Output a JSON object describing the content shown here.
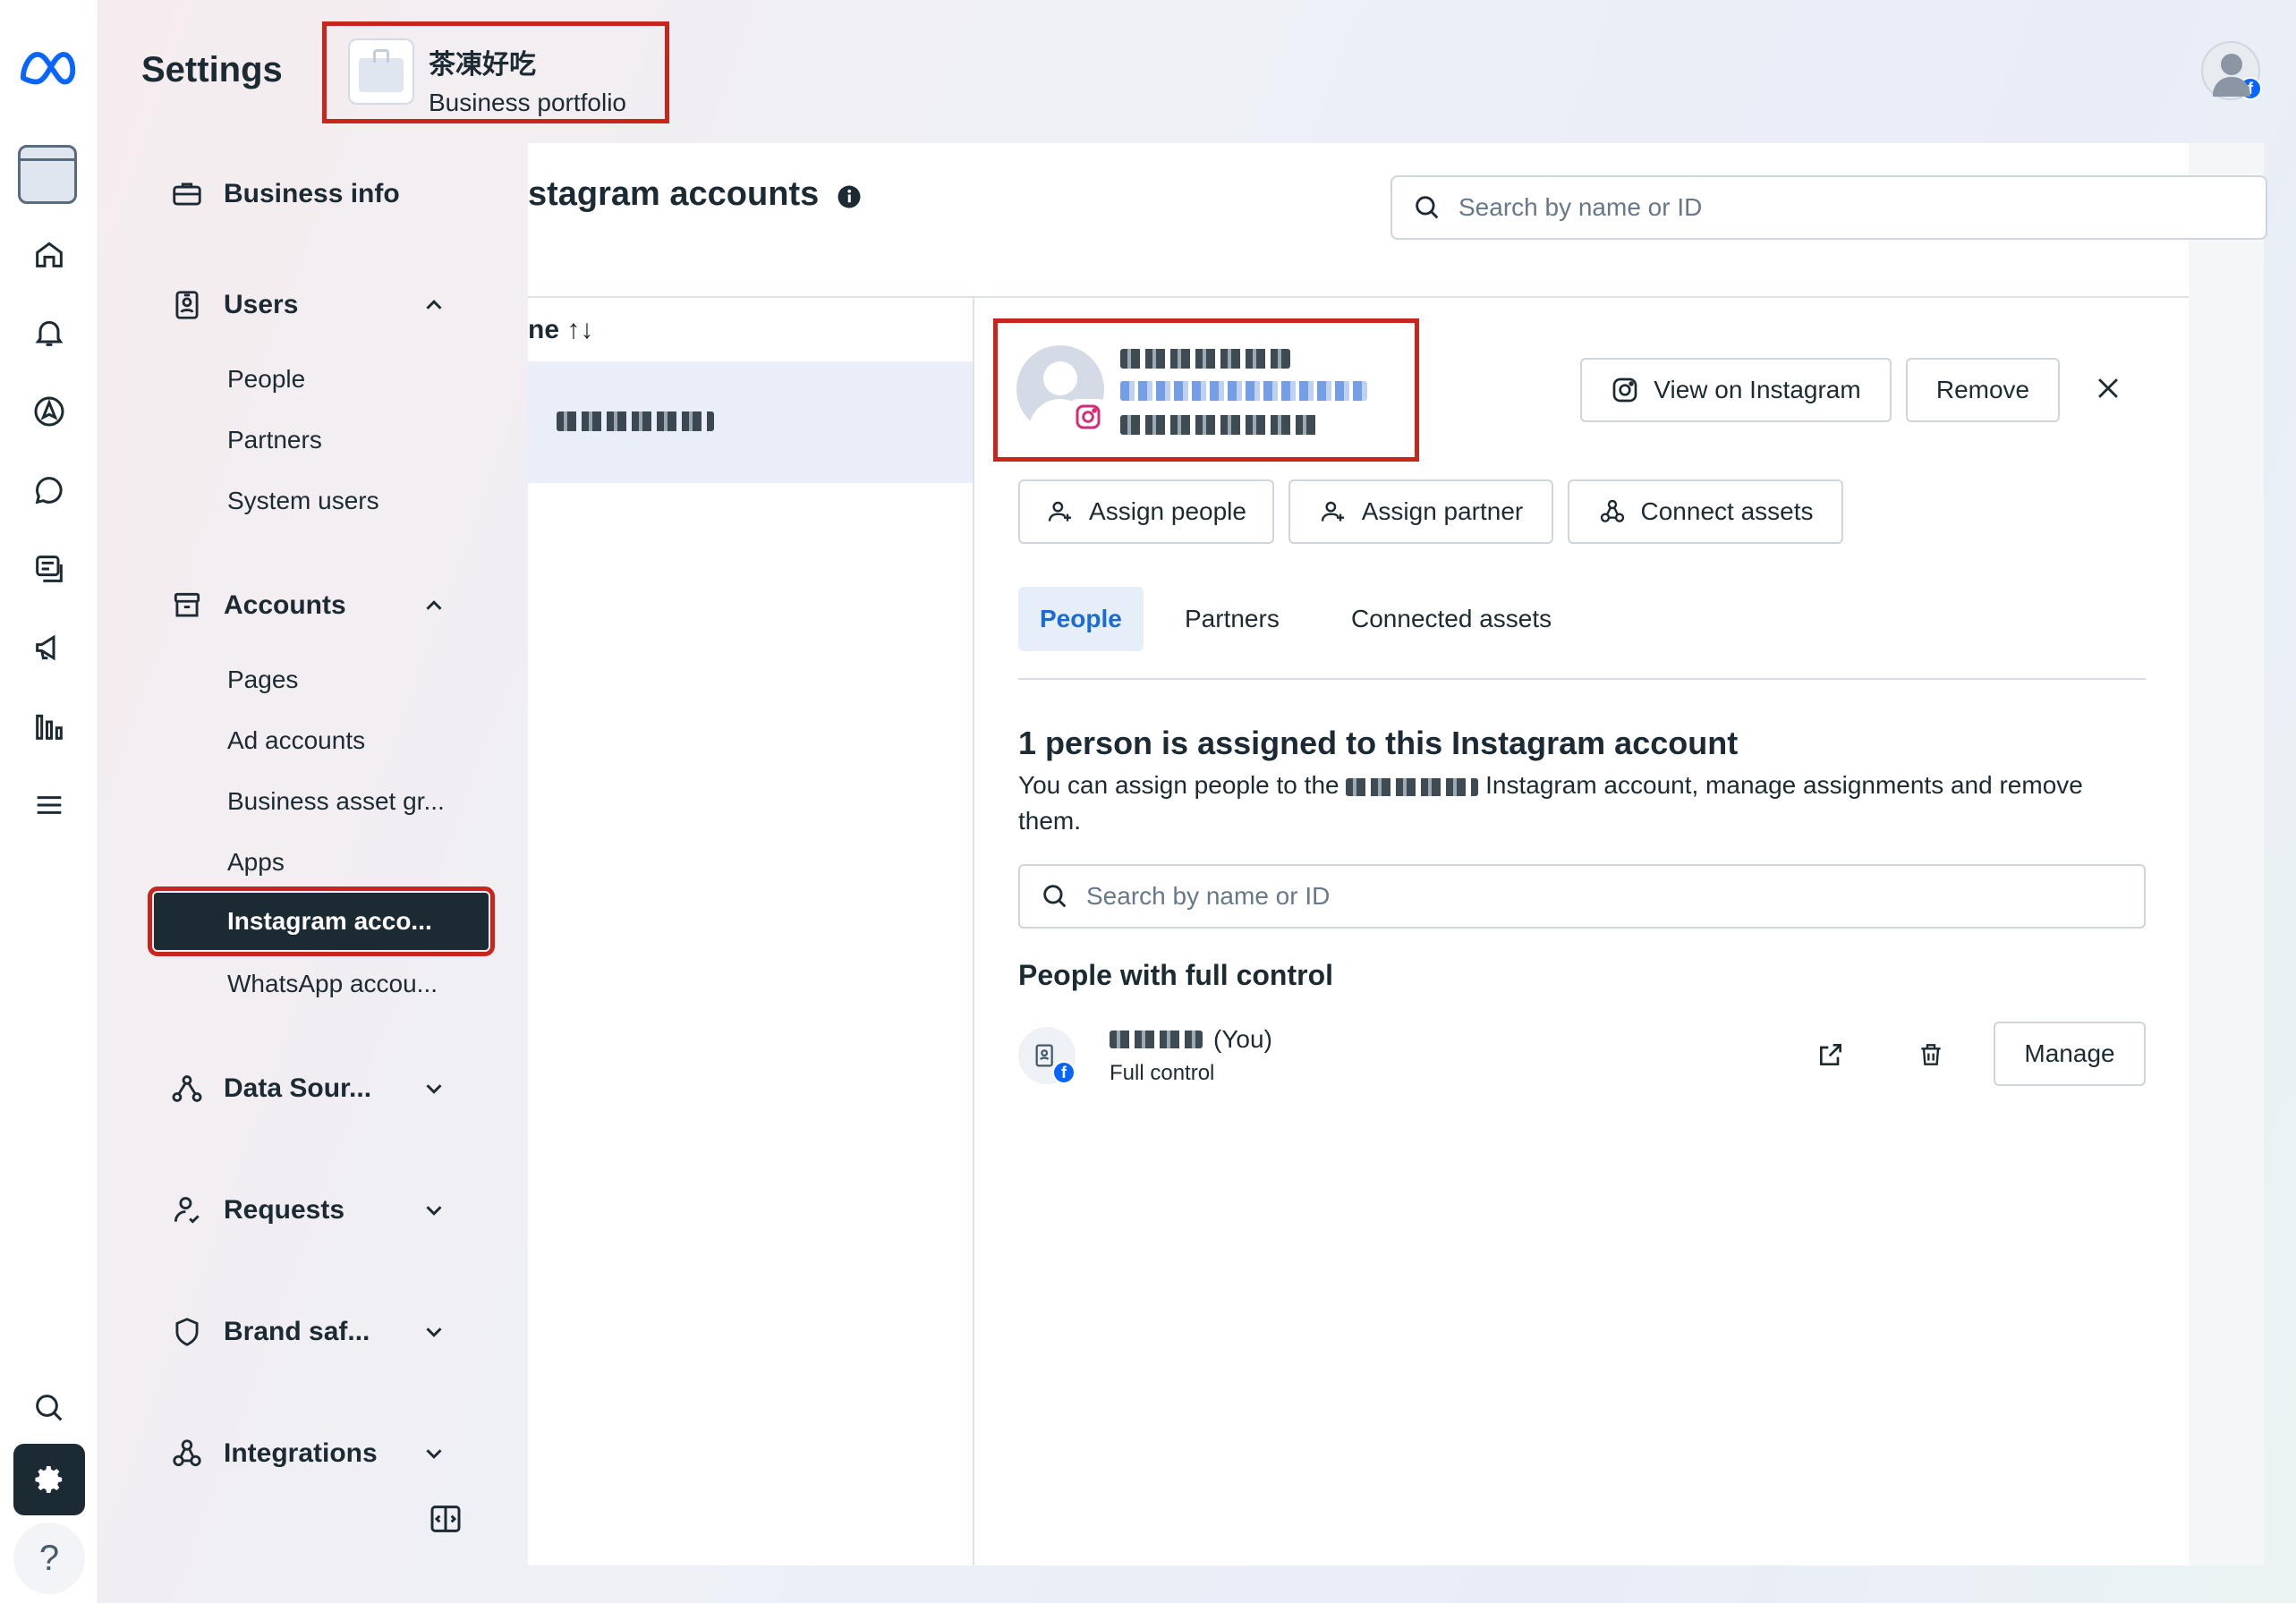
{
  "header": {
    "title": "Settings",
    "portfolio_name": "茶凍好吃",
    "portfolio_sub": "Business portfolio"
  },
  "sidebar": {
    "business_info": "Business info",
    "users": {
      "label": "Users",
      "items": [
        "People",
        "Partners",
        "System users"
      ]
    },
    "accounts": {
      "label": "Accounts",
      "items": [
        "Pages",
        "Ad accounts",
        "Business asset gr...",
        "Apps",
        "Instagram acco...",
        "WhatsApp accou..."
      ],
      "active_index": 4
    },
    "data_sources": "Data Sour...",
    "requests": "Requests",
    "brand_safety": "Brand saf...",
    "integrations": "Integrations"
  },
  "main": {
    "title": "stagram accounts",
    "search_placeholder": "Search by name or ID",
    "column_header": "ne ↑↓"
  },
  "detail": {
    "buttons": {
      "view": "View on Instagram",
      "remove": "Remove",
      "assign_people": "Assign people",
      "assign_partner": "Assign partner",
      "connect_assets": "Connect assets"
    },
    "tabs": [
      "People",
      "Partners",
      "Connected assets"
    ],
    "active_tab": "People",
    "assign_title": "1 person is assigned to this Instagram account",
    "assign_desc_pre": "You can assign people to the",
    "assign_desc_post": "Instagram account, manage assignments and remove them.",
    "search_placeholder": "Search by name or ID",
    "section_title": "People with full control",
    "person": {
      "you_label": "(You)",
      "role": "Full control",
      "manage": "Manage"
    }
  },
  "colors": {
    "accent": "#1b6bd6",
    "highlight_outline": "#c8261c",
    "dark_active": "#1c2b33"
  }
}
